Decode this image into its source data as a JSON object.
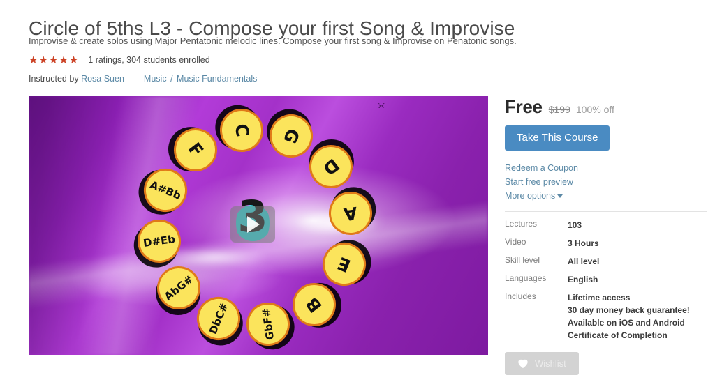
{
  "header": {
    "title": "Circle of 5ths L3 - Compose your first Song & Improvise",
    "subtitle": "Improvise & create solos using Major Pentatonic melodic lines. Compose your first song & Improvise on Penatonic songs.",
    "stars": 5,
    "rating_text": "1 ratings, 304 students enrolled",
    "instructed_by_label": "Instructed by",
    "instructor": "Rosa Suen",
    "breadcrumb": {
      "category": "Music",
      "separator": "/",
      "subcategory": "Music Fundamentals"
    }
  },
  "preview": {
    "name": "course-preview-video",
    "play_icon": "play-icon",
    "logo_text": "3",
    "discs": [
      {
        "lines": [
          "C"
        ]
      },
      {
        "lines": [
          "G"
        ]
      },
      {
        "lines": [
          "D"
        ]
      },
      {
        "lines": [
          "A"
        ]
      },
      {
        "lines": [
          "E"
        ]
      },
      {
        "lines": [
          "B"
        ]
      },
      {
        "lines": [
          "Gb",
          "F#"
        ]
      },
      {
        "lines": [
          "Db",
          "C#"
        ]
      },
      {
        "lines": [
          "Ab",
          "G#"
        ]
      },
      {
        "lines": [
          "D#",
          "Eb"
        ]
      },
      {
        "lines": [
          "A#",
          "Bb"
        ]
      },
      {
        "lines": [
          "F"
        ]
      }
    ],
    "colors": {
      "disc_fill": "#fbe45c",
      "disc_ring": "#e07a18",
      "background_purple": "#a431c9",
      "logo_cyan": "#2ee6ee"
    }
  },
  "sidebar": {
    "price": {
      "current": "Free",
      "original": "$199",
      "discount": "100% off"
    },
    "cta_label": "Take This Course",
    "links": [
      {
        "label": "Redeem a Coupon",
        "name": "redeem-coupon-link",
        "caret": false
      },
      {
        "label": "Start free preview",
        "name": "start-free-preview-link",
        "caret": false
      },
      {
        "label": "More options",
        "name": "more-options-link",
        "caret": true
      }
    ],
    "meta": [
      {
        "key": "Lectures",
        "values": [
          "103"
        ]
      },
      {
        "key": "Video",
        "values": [
          "3 Hours"
        ]
      },
      {
        "key": "Skill level",
        "values": [
          "All level"
        ]
      },
      {
        "key": "Languages",
        "values": [
          "English"
        ]
      },
      {
        "key": "Includes",
        "values": [
          "Lifetime access",
          "30 day money back guarantee!",
          "Available on iOS and Android",
          "Certificate of Completion"
        ]
      }
    ],
    "wishlist_label": "Wishlist",
    "wishlist_icon": "heart-icon",
    "colors": {
      "cta_blue": "#4a8bc2",
      "link_blue": "#5b89a6",
      "star_red": "#cc4124",
      "wishlist_gray": "#d3d3d3"
    }
  }
}
